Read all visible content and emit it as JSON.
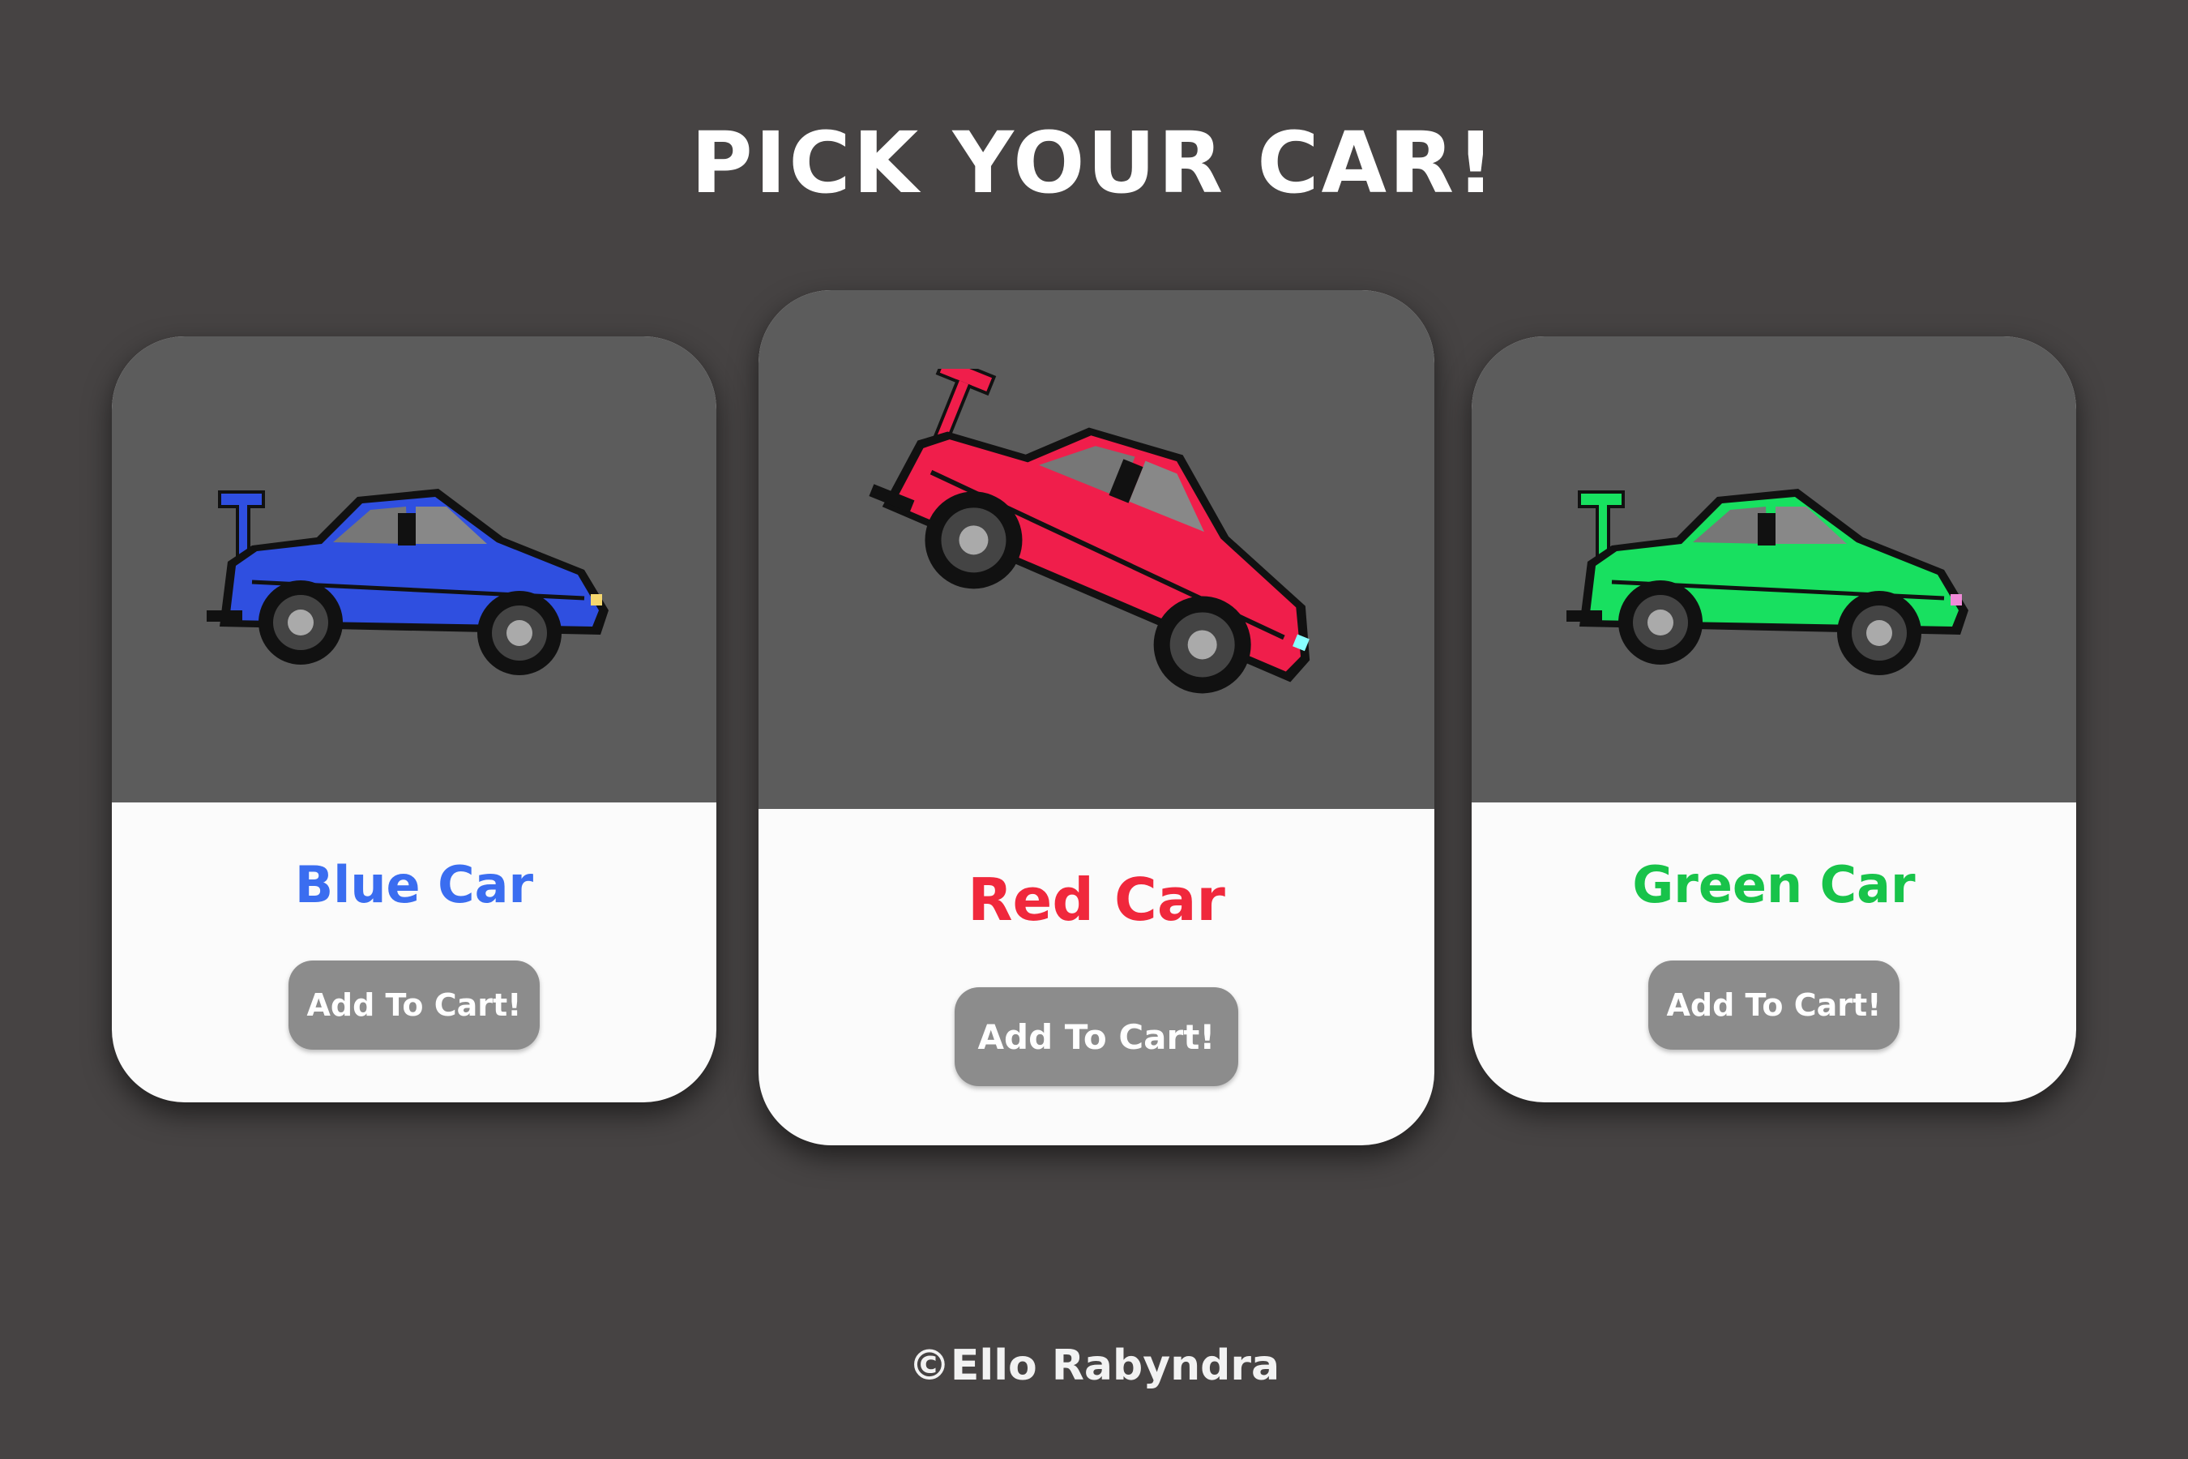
{
  "page": {
    "title": "PICK YOUR CAR!",
    "footer": "©Ello Rabyndra",
    "background_color": "#464343"
  },
  "cards": [
    {
      "id": "blue",
      "name": "Blue Car",
      "name_color": "#3a6df0",
      "car_color": "#2f4fe0",
      "car_icon": "blue-race-car-icon",
      "button_label": "Add To Cart!"
    },
    {
      "id": "red",
      "name": "Red Car",
      "name_color": "#f0283c",
      "car_color": "#f01e4b",
      "car_icon": "red-race-car-icon",
      "highlighted": true,
      "button_label": "Add To Cart!"
    },
    {
      "id": "green",
      "name": "Green Car",
      "name_color": "#18c34a",
      "car_color": "#18e060",
      "car_icon": "green-race-car-icon",
      "button_label": "Add To Cart!"
    }
  ]
}
